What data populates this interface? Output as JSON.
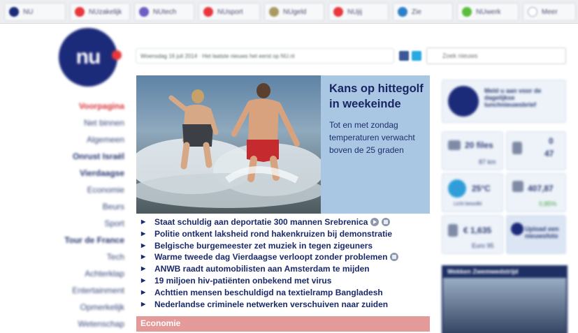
{
  "tabs": [
    {
      "label": "NU",
      "color": "#1c2a7a"
    },
    {
      "label": "NUzakelijk",
      "color": "#e8383d"
    },
    {
      "label": "NUtech",
      "color": "#6b5fc4"
    },
    {
      "label": "NUsport",
      "color": "#e8383d"
    },
    {
      "label": "NUgeld",
      "color": "#a89a62"
    },
    {
      "label": "NUjij",
      "color": "#e8383d"
    },
    {
      "label": "Zie",
      "color": "#2d7fc9"
    },
    {
      "label": "NUwerk",
      "color": "#5bbd3c"
    },
    {
      "label": "Meer",
      "color": "#ffffff"
    }
  ],
  "logo": {
    "text": "nu"
  },
  "dateline": "Woensdag 16 juli 2014 · Het laatste nieuws het eerst op NU.nl",
  "search": {
    "placeholder": "Zoek nieuws"
  },
  "nav": [
    {
      "label": "Voorpagina",
      "style": "active"
    },
    {
      "label": "Net binnen",
      "style": "normal"
    },
    {
      "label": "Algemeen",
      "style": "normal"
    },
    {
      "label": "Onrust Israël",
      "style": "bold"
    },
    {
      "label": "Vierdaagse",
      "style": "bold"
    },
    {
      "label": "Economie",
      "style": "normal"
    },
    {
      "label": "Beurs",
      "style": "normal"
    },
    {
      "label": "Sport",
      "style": "normal"
    },
    {
      "label": "Tour de France",
      "style": "bold"
    },
    {
      "label": "Tech",
      "style": "normal"
    },
    {
      "label": "Achterklap",
      "style": "normal"
    },
    {
      "label": "Entertainment",
      "style": "normal"
    },
    {
      "label": "Opmerkelijk",
      "style": "normal"
    },
    {
      "label": "Wetenschap",
      "style": "normal"
    }
  ],
  "hero": {
    "title": "Kans op hittegolf in weekeinde",
    "subtitle": "Tot en met zondag temperaturen verwacht boven de 25 graden"
  },
  "headlines": [
    {
      "text": "Staat schuldig aan deportatie 300 mannen Srebrenica",
      "icons": [
        "play",
        "photo"
      ]
    },
    {
      "text": "Politie ontkent laksheid rond hakenkruizen bij demonstratie",
      "icons": []
    },
    {
      "text": "Belgische burgemeester zet muziek in tegen zigeuners",
      "icons": []
    },
    {
      "text": "Warme tweede dag Vierdaagse verloopt zonder problemen",
      "icons": [
        "photo"
      ]
    },
    {
      "text": "ANWB raadt automobilisten aan Amsterdam te mijden",
      "icons": []
    },
    {
      "text": "19 miljoen hiv-patiënten onbekend met virus",
      "icons": []
    },
    {
      "text": "Achttien mensen beschuldigd na textielramp Bangladesh",
      "icons": []
    },
    {
      "text": "Nederlandse criminele netwerken verschuiven naar zuiden",
      "icons": []
    }
  ],
  "section": {
    "label": "Economie"
  },
  "right": {
    "promo": "Meld u aan voor de dagelijkse lunchnieuwsbrief",
    "traffic": "20 files",
    "traffic_sub": "87 km",
    "train": "0",
    "train2": "47",
    "weather": "25°C",
    "weather_sub": "Licht bewolkt",
    "aex": "407,87",
    "aex_change": "0,85%",
    "euro": "€ 1,635",
    "euro_sub": "Euro 95",
    "upload": "Upload een nieuwsfoto",
    "video_title": "Wekken Zwemwedstrijd"
  }
}
